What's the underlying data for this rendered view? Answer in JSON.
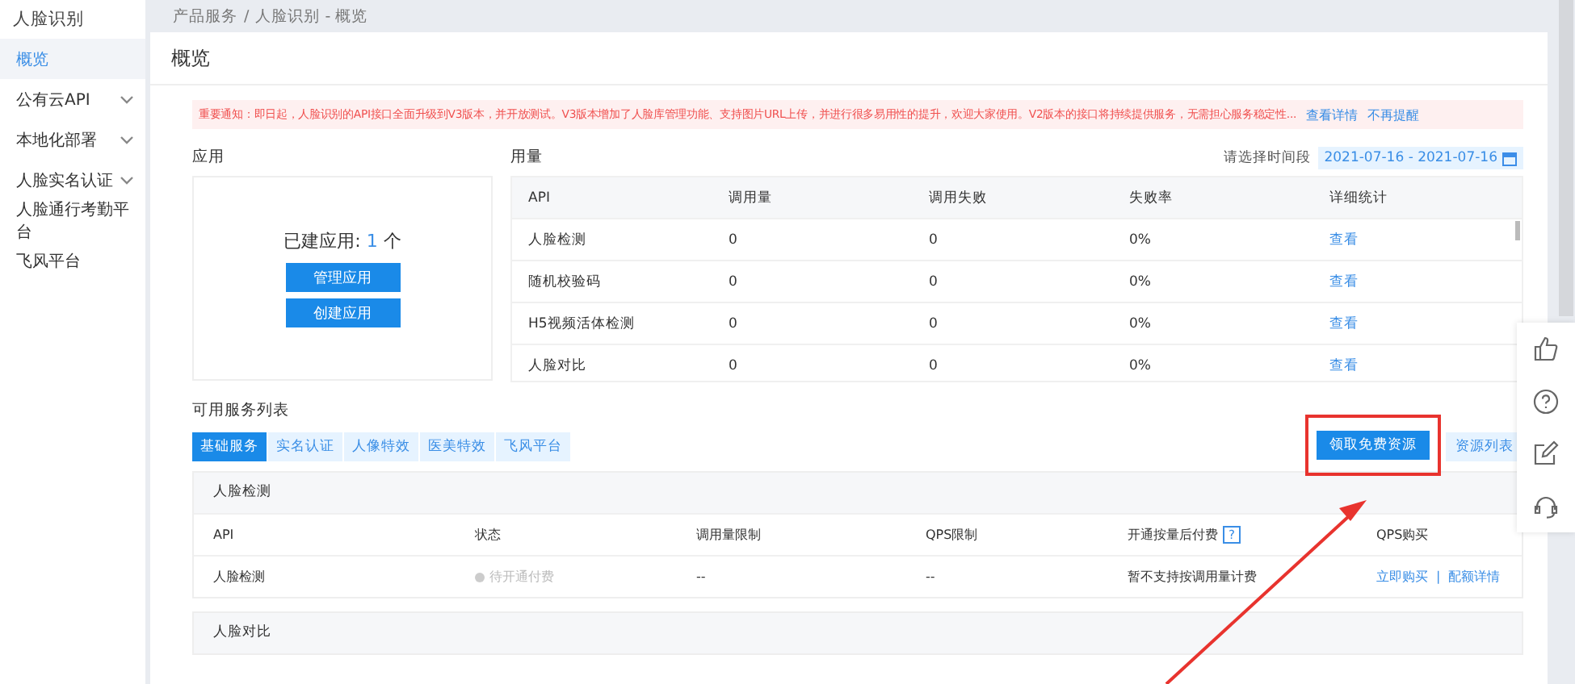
{
  "sidebar": {
    "title": "人脸识别",
    "items": [
      {
        "label": "概览",
        "selected": true,
        "expandable": false
      },
      {
        "label": "公有云API",
        "selected": false,
        "expandable": true
      },
      {
        "label": "本地化部署",
        "selected": false,
        "expandable": true
      },
      {
        "label": "人脸实名认证",
        "selected": false,
        "expandable": true
      },
      {
        "label": "人脸通行考勤平台",
        "selected": false,
        "expandable": false
      },
      {
        "label": "飞风平台",
        "selected": false,
        "expandable": false
      }
    ]
  },
  "breadcrumb": [
    "产品服务",
    "/",
    "人脸识别 - 概览"
  ],
  "page_title": "概览",
  "notice": {
    "text": "重要通知：即日起，人脸识别的API接口全面升级到V3版本，并开放测试。V3版本增加了人脸库管理功能、支持图片URL上传，并进行很多易用性的提升，欢迎大家使用。V2版本的接口将持续提供服务，无需担心服务稳定性...",
    "links": [
      "查看详情",
      "不再提醒"
    ]
  },
  "apps": {
    "heading": "应用",
    "count_label": "已建应用:",
    "count": "1",
    "unit": "个",
    "buttons": [
      "管理应用",
      "创建应用"
    ]
  },
  "usage": {
    "heading": "用量",
    "date_label": "请选择时间段",
    "date_range": "2021-07-16 - 2021-07-16",
    "columns": [
      "API",
      "调用量",
      "调用失败",
      "失败率",
      "详细统计"
    ],
    "rows": [
      {
        "cells": [
          "人脸检测",
          "0",
          "0",
          "0%"
        ],
        "link": "查看"
      },
      {
        "cells": [
          "随机校验码",
          "0",
          "0",
          "0%"
        ],
        "link": "查看"
      },
      {
        "cells": [
          "H5视频活体检测",
          "0",
          "0",
          "0%"
        ],
        "link": "查看"
      },
      {
        "cells": [
          "人脸对比",
          "0",
          "0",
          "0%"
        ],
        "link": "查看"
      }
    ]
  },
  "services": {
    "heading": "可用服务列表",
    "tabs": [
      {
        "label": "基础服务",
        "selected": true
      },
      {
        "label": "实名认证",
        "selected": false
      },
      {
        "label": "人像特效",
        "selected": false
      },
      {
        "label": "医美特效",
        "selected": false
      },
      {
        "label": "飞风平台",
        "selected": false
      }
    ],
    "buttons": [
      {
        "label": "领取免费资源",
        "kind": "primary"
      },
      {
        "label": "资源列表",
        "kind": "plain"
      }
    ],
    "sections": [
      {
        "title": "人脸检测",
        "columns": [
          {
            "label": "API"
          },
          {
            "label": "状态"
          },
          {
            "label": "调用量限制"
          },
          {
            "label": "QPS限制"
          },
          {
            "label": "开通按量后付费",
            "help": "?"
          },
          {
            "label": "QPS购买"
          }
        ],
        "rows": [
          {
            "api": "人脸检测",
            "status": "待开通付费",
            "call_limit": "--",
            "qps_limit": "--",
            "billing": "暂不支持按调用量计费",
            "links": [
              "立即购买",
              "配额详情"
            ],
            "separator": "|"
          }
        ]
      },
      {
        "title": "人脸对比"
      }
    ]
  }
}
